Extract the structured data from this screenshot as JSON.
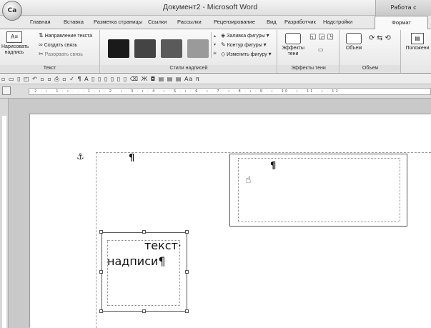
{
  "title_bar": {
    "office_button": "Ca",
    "document_title": "Документ2 - Microsoft Word",
    "context_title": "Работа с надписями"
  },
  "tabs": [
    {
      "label": "Главная"
    },
    {
      "label": "Вставка"
    },
    {
      "label": "Разметка страницы"
    },
    {
      "label": "Ссылки"
    },
    {
      "label": "Рассылки"
    },
    {
      "label": "Рецензирование"
    },
    {
      "label": "Вид"
    },
    {
      "label": "Разработчик"
    },
    {
      "label": "Надстройки"
    },
    {
      "label": "Формат"
    }
  ],
  "ribbon": {
    "text_group": {
      "label": "Текст",
      "draw_button_line1": "Нарисовать",
      "draw_button_line2": "надпись",
      "text_direction": "Направление текста",
      "create_link": "Создать связь",
      "break_link": "Разорвать связь"
    },
    "styles_group": {
      "label": "Стили надписей",
      "shape_fill": "Заливка фигуры",
      "shape_outline": "Контур фигуры",
      "change_shape": "Изменить фигуру",
      "swatch_colors": [
        "#1a1a1a",
        "#444444",
        "#5a5a5a",
        "#9a9a9a"
      ]
    },
    "shadow_group": {
      "label": "Эффекты тени",
      "shadow_effects_line1": "Эффекты",
      "shadow_effects_line2": "тени"
    },
    "volume_group": {
      "label": "Объем",
      "volume_button": "Объем"
    },
    "position_group": {
      "position_button": "Положени"
    }
  },
  "quick_access": {
    "toolbar_text": "▫ ▭ ▯ ◰ ↶ ▫ ▫ ⎙ ▫ ✓ ¶ A ▯ ▯ ▯ ▯ ▯ ▯ ⌫ Ж ◘ ▤ ▤ ▤ Aa π"
  },
  "ruler": {
    "ticks": "· 2 · ı · 1 · ı · · · 1 · ı · 2 · ı · 3 · ı · 4 · ı · 5 · ı · 6 · ı · 7 · ı · 8 · ı · 9 · ı · 10 · ı · 11 · ı · 12"
  },
  "document": {
    "anchor_icon": "⚓",
    "paragraph_mark": "¶",
    "textbox1_paragraph_mark": "¶",
    "textbox2_line1": "текст·",
    "textbox2_line2": "надписи¶"
  }
}
